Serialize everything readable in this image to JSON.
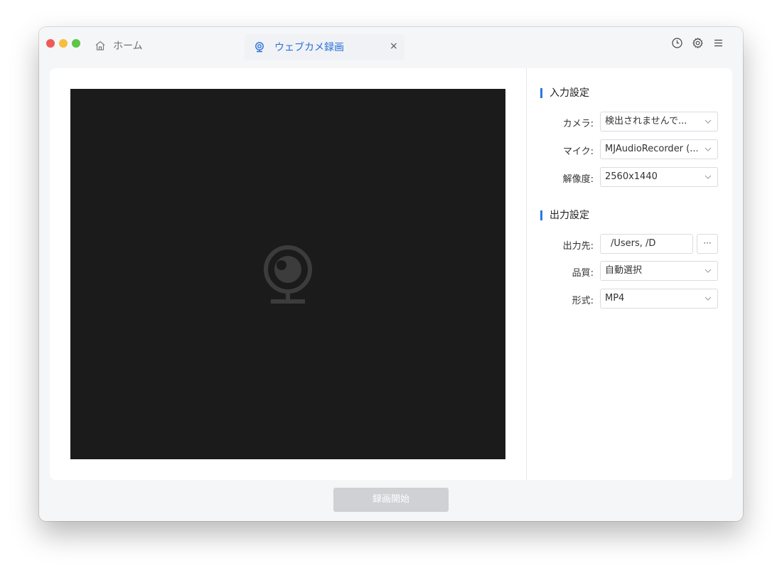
{
  "window": {
    "traffic_colors": {
      "red": "#ee5c55",
      "yellow": "#f5be3f",
      "green": "#5cc646"
    }
  },
  "tabs": {
    "home_label": "ホーム",
    "active_label": "ウェブカメ録画",
    "close_glyph": "×"
  },
  "toolbar": {
    "icons": [
      "history-icon",
      "gear-icon",
      "menu-icon"
    ]
  },
  "preview": {
    "background": "#1b1b1b",
    "icon": "webcam-icon"
  },
  "input_settings": {
    "title": "入力設定",
    "camera_label": "カメラ:",
    "camera_value": "検出されませんで...",
    "mic_label": "マイク:",
    "mic_value": "MJAudioRecorder (...",
    "resolution_label": "解像度:",
    "resolution_value": "2560x1440"
  },
  "output_settings": {
    "title": "出力設定",
    "dest_label": "出力先:",
    "dest_value": "/Users,         /D",
    "browse_label": "···",
    "quality_label": "品質:",
    "quality_value": "自動選択",
    "format_label": "形式:",
    "format_value": "MP4"
  },
  "record": {
    "label": "録画開始"
  },
  "colors": {
    "accent": "#2b78e4",
    "tab_text": "#2a6ed8",
    "disabled_button": "#cfd1d5"
  }
}
